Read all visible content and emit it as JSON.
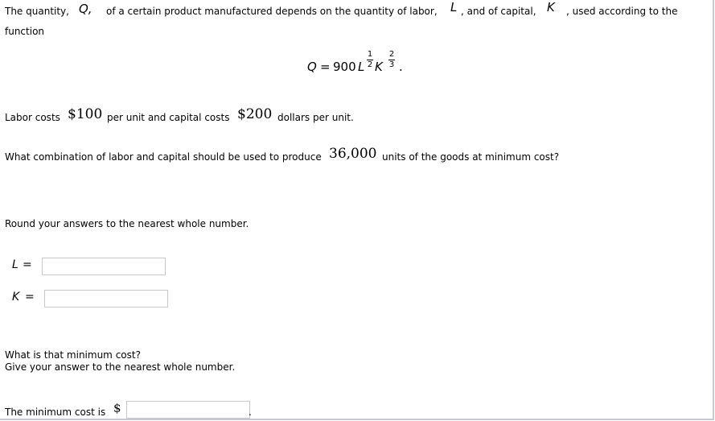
{
  "problem": {
    "intro_part1": "The quantity,",
    "var_Q": "Q,",
    "intro_part2": "of a certain product manufactured depends on the quantity of labor,",
    "var_L": "L",
    "intro_part3": ", and of capital,",
    "var_K": "K",
    "intro_part4": ", used according to the",
    "intro_part5": "function",
    "formula": {
      "lhs": "Q",
      "equals": "=",
      "coefficient": "900",
      "var1": "L",
      "exp1_num": "1",
      "exp1_den": "2",
      "var2": "K",
      "exp2_num": "2",
      "exp2_den": "3",
      "period": "."
    },
    "costs_part1": "Labor costs",
    "labor_cost": "$100",
    "costs_part2": "per unit and capital costs",
    "capital_cost": "$200",
    "costs_part3": "dollars per unit.",
    "question_part1": "What combination of labor and capital should be used to produce",
    "units": "36,000",
    "question_part2": "units of the goods at minimum cost?",
    "round_note": "Round your answers to the nearest whole number."
  },
  "answers": {
    "L_label": "L",
    "L_equals": "=",
    "L_value": "",
    "K_label": "K",
    "K_equals": "=",
    "K_value": "",
    "min_cost_question": "What is that minimum cost?",
    "min_cost_note": "Give your answer to the nearest whole number.",
    "min_cost_label": "The minimum cost is",
    "currency": "$",
    "min_cost_value": "",
    "trailing_period": "."
  }
}
